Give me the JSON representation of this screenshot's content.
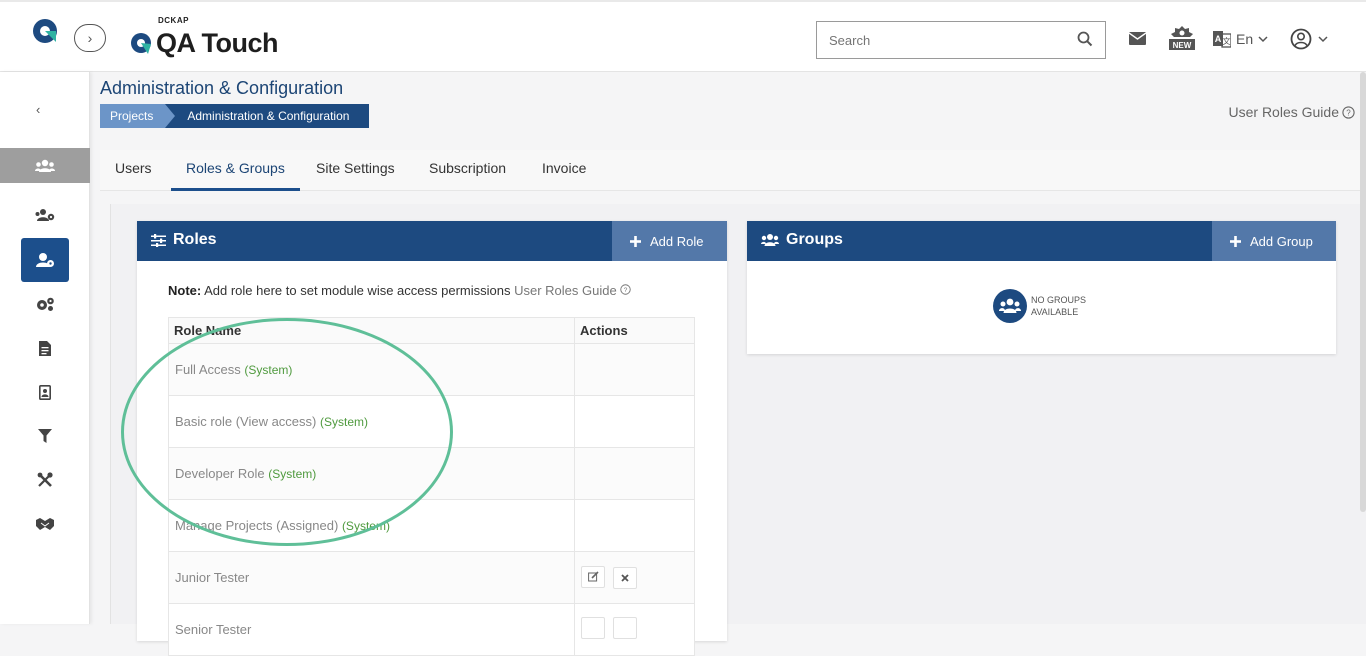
{
  "header": {
    "brand_sub": "DCKAP",
    "brand_name": "QA Touch",
    "search_placeholder": "Search",
    "language": "En"
  },
  "page": {
    "title": "Administration & Configuration",
    "breadcrumb": [
      "Projects",
      "Administration & Configuration"
    ],
    "guide_link": "User Roles Guide"
  },
  "tabs": [
    "Users",
    "Roles & Groups",
    "Site Settings",
    "Subscription",
    "Invoice"
  ],
  "active_tab": "Roles & Groups",
  "roles_panel": {
    "title": "Roles",
    "add_label": "Add Role",
    "note_bold": "Note:",
    "note_text": " Add role here to set module wise access permissions ",
    "note_link": "User Roles Guide",
    "columns": [
      "Role Name",
      "Actions"
    ],
    "rows": [
      {
        "name": "Full Access",
        "tag": "(System)"
      },
      {
        "name": "Basic role (View access)",
        "tag": "(System)"
      },
      {
        "name": "Developer Role",
        "tag": "(System)"
      },
      {
        "name": "Manage Projects (Assigned)",
        "tag": "(System)"
      },
      {
        "name": "Junior Tester",
        "tag": ""
      },
      {
        "name": "Senior Tester",
        "tag": ""
      }
    ]
  },
  "groups_panel": {
    "title": "Groups",
    "add_label": "Add Group",
    "empty_line1": "NO GROUPS",
    "empty_line2": "AVAILABLE"
  },
  "colors": {
    "primary": "#1d4a80",
    "breadcrumb_light": "#6c95c8",
    "system_tag": "#4f9a3e",
    "highlight": "#5fbf98"
  }
}
